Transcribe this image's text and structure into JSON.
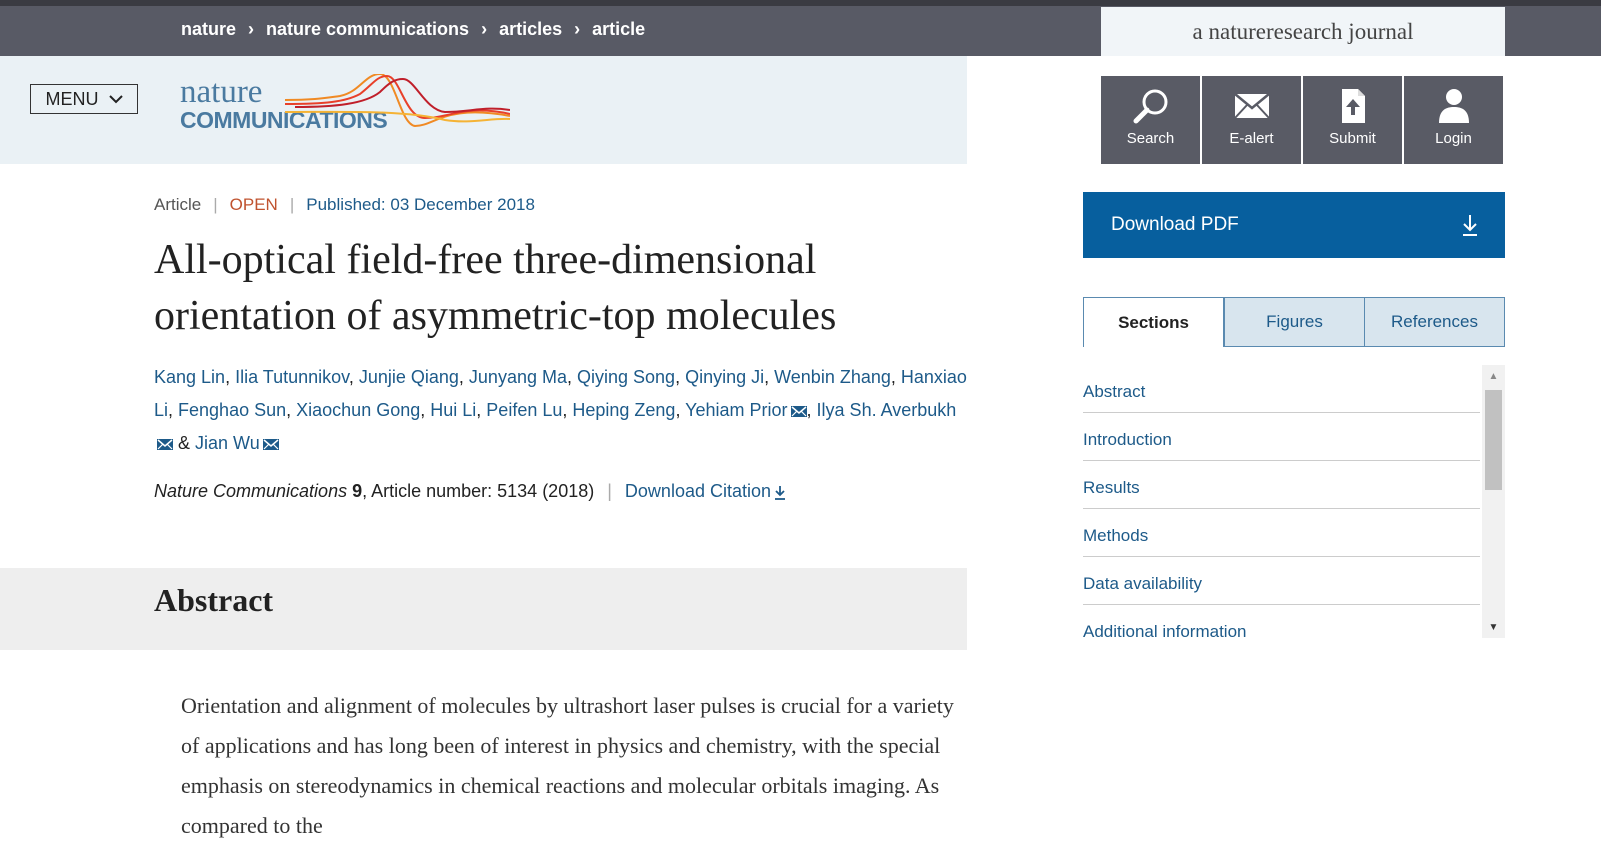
{
  "breadcrumb": [
    {
      "label": "nature"
    },
    {
      "label": "nature communications"
    },
    {
      "label": "articles"
    },
    {
      "label": "article"
    }
  ],
  "tagline": "a natureresearch journal",
  "menu": {
    "label": "MENU"
  },
  "logo": {
    "line1": "nature",
    "line2": "COMMUNICATIONS"
  },
  "tools": [
    {
      "label": "Search",
      "icon": "search-icon"
    },
    {
      "label": "E-alert",
      "icon": "envelope-icon"
    },
    {
      "label": "Submit",
      "icon": "upload-document-icon"
    },
    {
      "label": "Login",
      "icon": "user-icon"
    }
  ],
  "download_pdf": {
    "label": "Download PDF",
    "icon": "download-arrow-icon"
  },
  "tabs": {
    "sections": "Sections",
    "figures": "Figures",
    "references": "References"
  },
  "sections": [
    "Abstract",
    "Introduction",
    "Results",
    "Methods",
    "Data availability",
    "Additional information"
  ],
  "article": {
    "type": "Article",
    "access": "OPEN",
    "published": "Published: 03 December 2018",
    "title": "All-optical field-free three-dimensional orientation of asymmetric-top molecules",
    "authors": [
      "Kang Lin",
      "Ilia Tutunnikov",
      "Junjie Qiang",
      "Junyang Ma",
      "Qiying Song",
      "Qinying Ji",
      "Wenbin Zhang",
      "Hanxiao Li",
      "Fenghao Sun",
      "Xiaochun Gong",
      "Hui Li",
      "Peifen Lu",
      "Heping Zeng",
      "Yehiam Prior",
      "Ilya Sh. Averbukh",
      "Jian Wu"
    ],
    "author_sep": ", ",
    "author_final_sep": " & ",
    "citation": {
      "journal": "Nature Communications",
      "volume": "9",
      "rest": ", Article number: 5134 (2018)",
      "download": "Download Citation"
    }
  },
  "abstract": {
    "heading": "Abstract",
    "text": "Orientation and alignment of molecules by ultrashort laser pulses is crucial for a variety of applications and has long been of interest in physics and chemistry, with the special emphasis on stereodynamics in chemical reactions and molecular orbitals imaging. As compared to the"
  },
  "colors": {
    "link": "#1d5a89",
    "open": "#c0532f",
    "pdf": "#075f9e",
    "topbar": "#585a65"
  }
}
